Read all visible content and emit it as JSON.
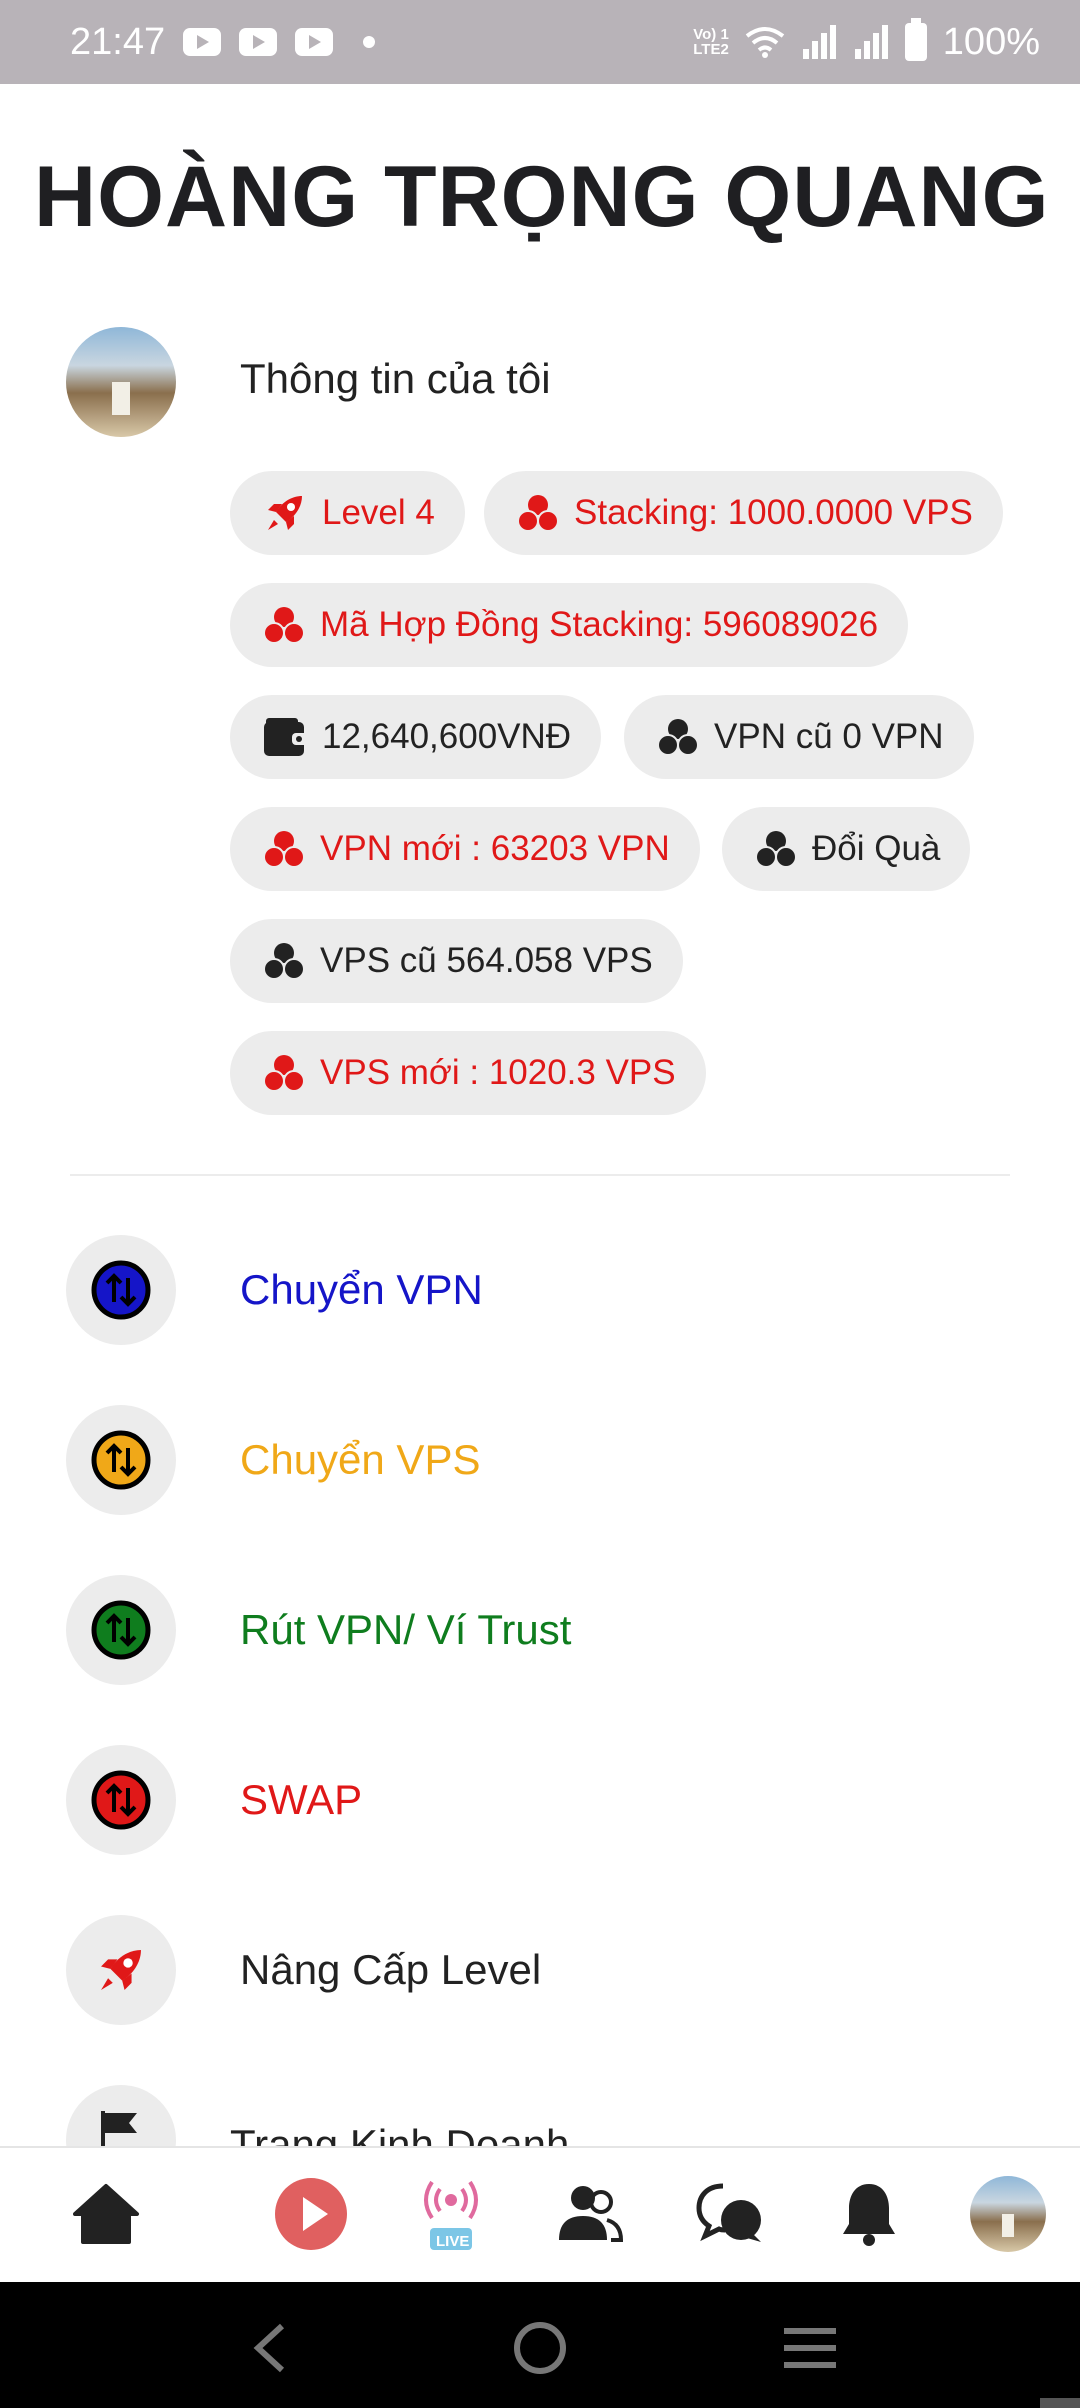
{
  "status_bar": {
    "time": "21:47",
    "network_label": "Vo) 1\nLTE2",
    "battery": "100%"
  },
  "page_title": "HOÀNG TRỌNG QUANG",
  "profile": {
    "label": "Thông tin của tôi"
  },
  "chips": {
    "level": "Level 4",
    "stacking": "Stacking: 1000.0000 VPS",
    "contract": "Mã Hợp Đồng Stacking: 596089026",
    "wallet": "12,640,600VNĐ",
    "vpn_old": "VPN cũ 0 VPN",
    "vpn_new": "VPN mới : 63203 VPN",
    "gift": "Đổi Quà",
    "vps_old": "VPS cũ 564.058 VPS",
    "vps_new": "VPS mới : 1020.3 VPS"
  },
  "menu": {
    "transfer_vpn": "Chuyển VPN",
    "transfer_vps": "Chuyển VPS",
    "withdraw_vpn": "Rút VPN/ Ví Trust",
    "swap": "SWAP",
    "upgrade_level": "Nâng Cấp Level",
    "business_page": "Trang Kinh Doanh"
  },
  "bottom_nav": {
    "live_badge": "LIVE"
  },
  "colors": {
    "red": "#e01818",
    "blue": "#1515c8",
    "orange": "#f0a818",
    "green": "#0f7d1e",
    "chip_bg": "#ececec",
    "status_bar_bg": "#b8b3b8"
  },
  "icons": {
    "level": "rocket-icon",
    "coin": "coins-icon",
    "wallet": "wallet-icon",
    "transfer": "swap-vertical-icon",
    "business": "flag-icon",
    "home": "home-icon",
    "play": "play-icon",
    "live": "live-broadcast-icon",
    "friends": "users-icon",
    "chat": "chat-icon",
    "notifications": "bell-icon"
  }
}
